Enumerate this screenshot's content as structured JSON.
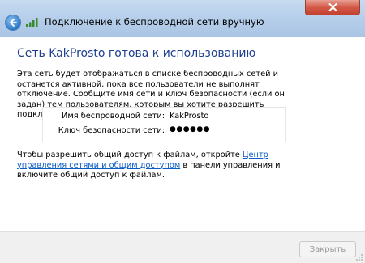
{
  "window": {
    "title": "Подключение к беспроводной сети вручную"
  },
  "main": {
    "heading": "Сеть KakProsto готова к использованию",
    "description": "Эта сеть будет отображаться в списке беспроводных сетей и останется активной, пока все пользователи не выполнят отключение. Сообщите имя сети и ключ безопасности (если он задан) тем пользователям, которым вы хотите разрешить подключаться к этой сети.",
    "network_name_label": "Имя беспроводной сети:",
    "network_name_value": "KakProsto",
    "security_key_label": "Ключ безопасности сети:",
    "security_key_value": "●●●●●●",
    "share_text_before": "Чтобы разрешить общий доступ к файлам, откройте ",
    "share_link": "Центр управления сетями и общим доступом",
    "share_text_after": " в панели управления и включите общий доступ к файлам."
  },
  "footer": {
    "close_label": "Закрыть"
  },
  "icons": {
    "back": "back-arrow-icon",
    "wifi": "wifi-signal-icon",
    "close": "close-icon"
  },
  "colors": {
    "heading": "#1e3f8f",
    "link": "#0b5cc7",
    "close_button": "#c44130"
  }
}
